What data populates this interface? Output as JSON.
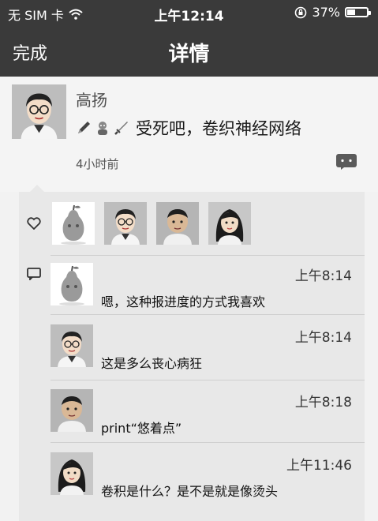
{
  "status_bar": {
    "carrier": "无 SIM 卡",
    "time": "上午12:14",
    "battery": "37%",
    "battery_level": 0.37
  },
  "nav": {
    "done_label": "完成",
    "title": "详情"
  },
  "post": {
    "author": "高扬",
    "text": "受死吧，卷织神经网络",
    "emoji_icons": [
      "pencil-icon",
      "character-icon",
      "sword-icon"
    ],
    "time": "4小时前",
    "comment_icon": "comment-icon"
  },
  "likes": {
    "icon": "heart-icon",
    "users": [
      "pear-avatar",
      "glasses-man-avatar",
      "short-hair-man-avatar",
      "long-hair-woman-avatar"
    ]
  },
  "comments": [
    {
      "avatar": "pear-avatar",
      "time": "上午8:14",
      "text": "嗯，这种报进度的方式我喜欢"
    },
    {
      "avatar": "glasses-man-avatar",
      "time": "上午8:14",
      "text": "这是多么丧心病狂"
    },
    {
      "avatar": "short-hair-man-avatar",
      "time": "上午8:18",
      "text": "print“悠着点”"
    },
    {
      "avatar": "long-hair-woman-avatar",
      "time": "上午11:46",
      "text": "卷积是什么？是不是就是像烫头"
    }
  ]
}
